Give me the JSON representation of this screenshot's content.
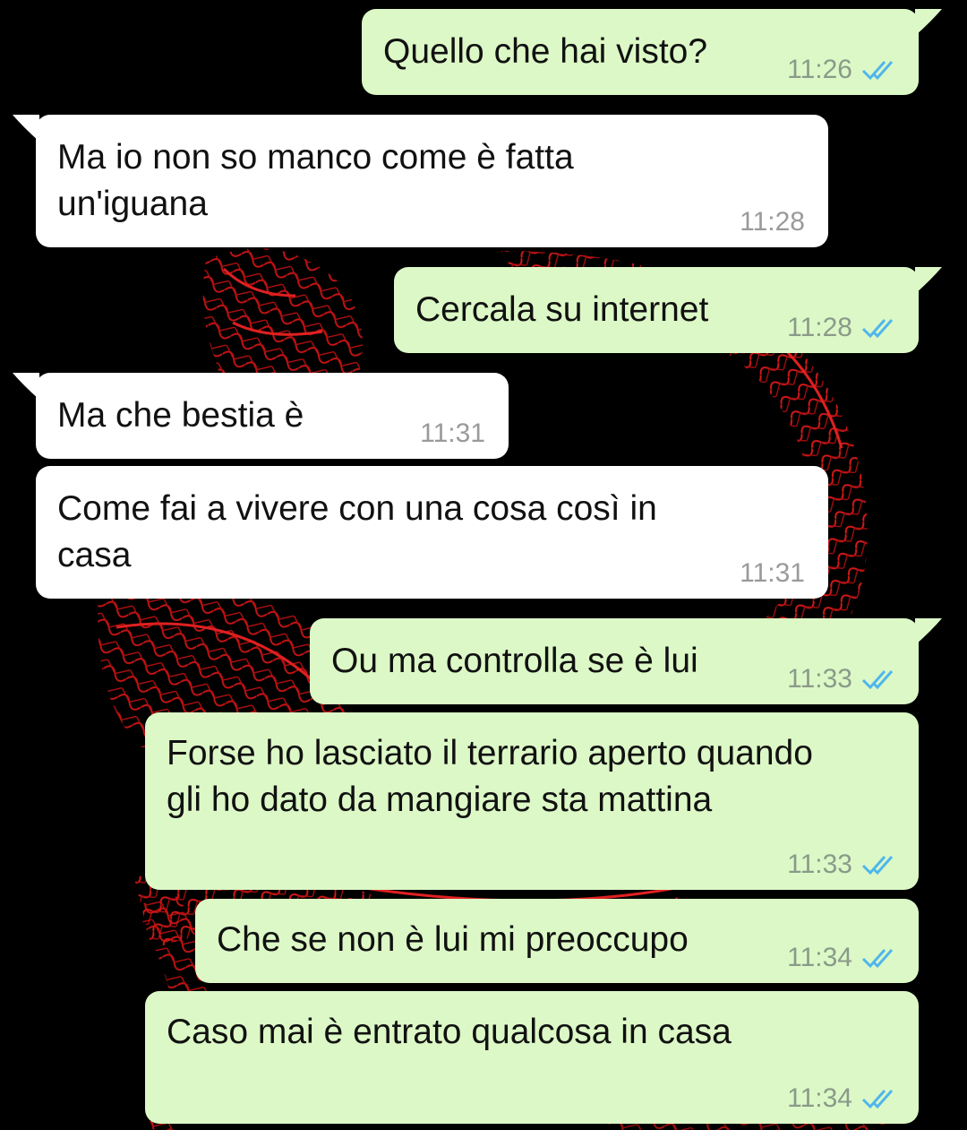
{
  "messages": [
    {
      "text": "Quello che hai visto?",
      "time": "11:26",
      "dir": "out",
      "read": true
    },
    {
      "text": "Ma io non so manco come è fatta\nun'iguana",
      "time": "11:28",
      "dir": "in"
    },
    {
      "text": "Cercala su internet",
      "time": "11:28",
      "dir": "out",
      "read": true
    },
    {
      "text": "Ma che bestia è",
      "time": "11:31",
      "dir": "in"
    },
    {
      "text": "Come fai a vivere con una cosa così in\ncasa",
      "time": "11:31",
      "dir": "in"
    },
    {
      "text": "Ou ma controlla se è lui",
      "time": "11:33",
      "dir": "out",
      "read": true
    },
    {
      "text": "Forse ho lasciato il terrario aperto quando\ngli ho dato da mangiare sta mattina",
      "time": "11:33",
      "dir": "out",
      "read": true
    },
    {
      "text": "Che se non è lui mi preoccupo",
      "time": "11:34",
      "dir": "out",
      "read": true
    },
    {
      "text": "Caso mai è entrato qualcosa in casa",
      "time": "11:34",
      "dir": "out",
      "read": true
    }
  ],
  "theme": {
    "background": "#000000",
    "outgoing_bubble": "#dcf8c6",
    "incoming_bubble": "#ffffff",
    "read_tick_color": "#4fb6ec",
    "wallpaper_accent": "#d01010"
  },
  "icons": {
    "read_receipt": "double-check-icon"
  }
}
